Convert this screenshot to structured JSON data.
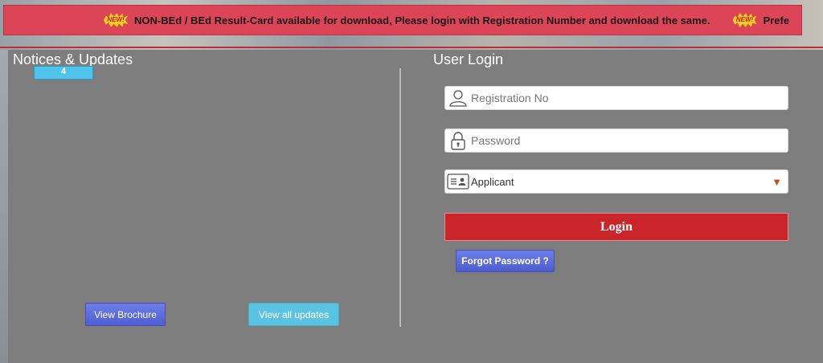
{
  "ticker": {
    "badge_text": "NEW!",
    "message": "NON-BEd / BEd Result-Card available for download, Please login with Registration Number and download the same.",
    "message_cut": "Prefe"
  },
  "notices": {
    "title": "Notices & Updates",
    "badge": "4",
    "view_brochure": "View Brochure",
    "view_all": "View all updates"
  },
  "login": {
    "title": "User Login",
    "registration_placeholder": "Registration No",
    "password_placeholder": "Password",
    "role_selected": "Applicant",
    "login_label": "Login",
    "forgot_label": "Forgot Password ?"
  },
  "icons": {
    "user": "user-icon",
    "lock": "lock-icon",
    "idcard": "id-card-icon",
    "caret": "chevron-down-icon",
    "new": "new-badge-icon"
  },
  "colors": {
    "ticker_bg": "#dc4457",
    "login_button": "#c9252b",
    "panel_bg": "#7d7d7d"
  }
}
